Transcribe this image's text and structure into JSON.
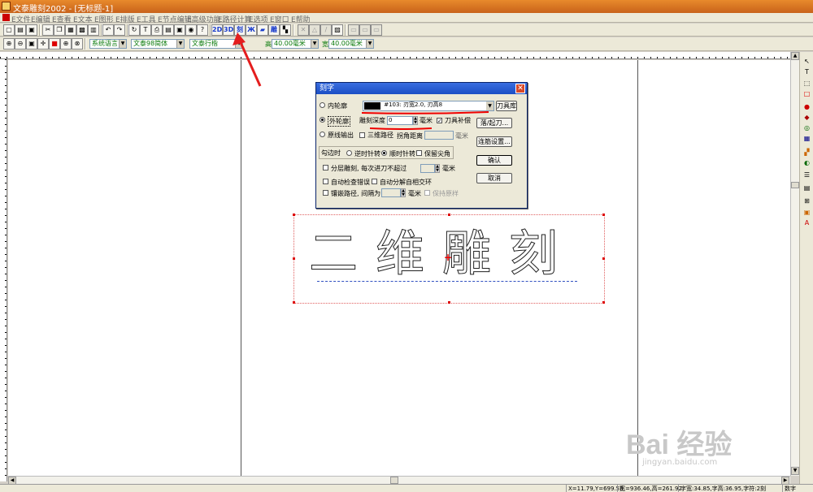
{
  "app": {
    "title": "文泰雕刻2002 - [无标题-1]"
  },
  "menu": [
    "E文件",
    "E编辑",
    "E查看",
    "E文本",
    "E图形",
    "E排版",
    "E工具",
    "E节点编辑",
    "E高级功能",
    "E路径计算",
    "E选项",
    "E窗口",
    "E帮助"
  ],
  "toolbar2": {
    "btn_2d": "2D",
    "btn_3d": "3D",
    "btn_carve": "刻"
  },
  "toolbar3": {
    "language": "系统语言",
    "font_family": "文泰98简体",
    "font_style": "文泰行楷",
    "height_label": "高",
    "height_value": "40.00毫米",
    "width_label": "宽",
    "width_value": "40.00毫米"
  },
  "canvas": {
    "carved_text": "二维雕刻"
  },
  "dialog": {
    "title": "刻字",
    "inner_contour": "内轮廓",
    "outer_contour": "外轮廓",
    "original_output": "原线输出",
    "tool_value": "#103: 刃宽2.0, 刃高8",
    "tool_library": "刀具库",
    "depth_label": "雕刻深度",
    "depth_value": "0",
    "depth_unit": "毫米",
    "tool_compensation": "刀具补偿",
    "drop_lift": "落/起刀...",
    "three_d_path": "三维路径",
    "corner_distance": "拐角距离",
    "corner_unit": "毫米",
    "continuous_settings": "连筋设置...",
    "walk_direction": "勾边时",
    "counterclockwise": "逆时针转",
    "clockwise": "顺时针转",
    "keep_sharp": "保留尖角",
    "ok": "确认",
    "cancel": "取消",
    "layered_carve": "分层雕刻, 每次进刀不超过",
    "layered_unit": "毫米",
    "auto_check": "自动检查错误",
    "auto_decompose": "自动分解自相交环",
    "inlay_path": "镶嵌路径, 间隔为",
    "inlay_unit": "毫米",
    "keep_original": "保持原样"
  },
  "status": {
    "coords": "X=11.79,Y=699.58",
    "size": "宽=936.46,高=261.92",
    "font_metrics": "字宽:34.85,字高:36.95,字符:2刻",
    "mode": "数字"
  },
  "watermark": {
    "brand": "Bai 经验",
    "url": "jingyan.baidu.com"
  }
}
